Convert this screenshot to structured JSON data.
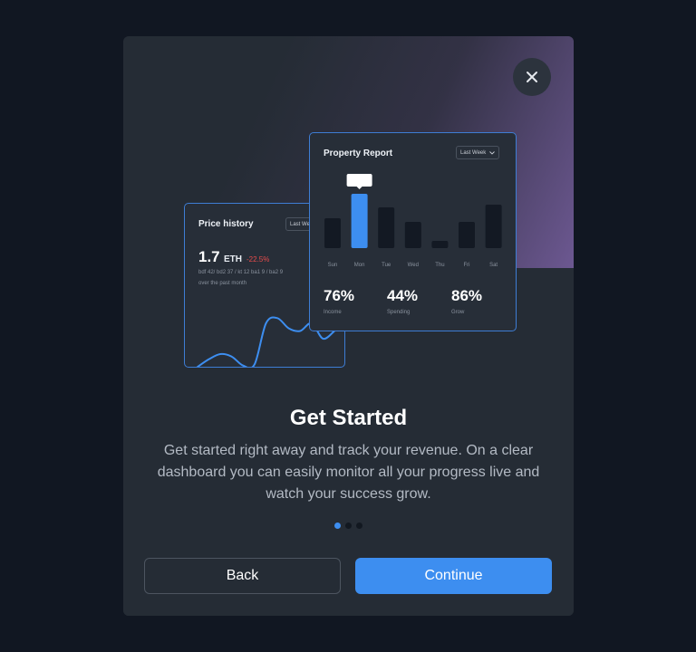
{
  "modal": {
    "close_icon": "close-icon",
    "heading": "Get Started",
    "description": "Get started right away and track your revenue. On a clear dashboard you can easily monitor all your progress live and watch your success grow.",
    "pagination": {
      "total": 3,
      "active": 1
    },
    "buttons": {
      "back": "Back",
      "continue": "Continue"
    }
  },
  "price_card": {
    "title": "Price history",
    "filter": "Last Week",
    "value": "1.7",
    "unit": "ETH",
    "change": "-22.5%",
    "meta_line1": "bdf 42/ bd2 37 / kt 12 ba1 9 / ba2 9",
    "meta_line2": "over the past month"
  },
  "report_card": {
    "title": "Property Report",
    "filter": "Last Week",
    "stats": [
      {
        "value": "76%",
        "label": "Income"
      },
      {
        "value": "44%",
        "label": "Spending"
      },
      {
        "value": "86%",
        "label": "Grow"
      }
    ]
  },
  "chart_data": [
    {
      "type": "bar",
      "categories": [
        "Sun",
        "Mon",
        "Tue",
        "Wed",
        "Thu",
        "Fri",
        "Sat"
      ],
      "values": [
        33,
        60,
        45,
        29,
        8,
        29,
        48
      ],
      "highlighted": "Mon",
      "ylim": [
        0,
        80
      ],
      "grid": false
    },
    {
      "type": "line",
      "x": [
        0,
        1,
        2,
        3,
        4,
        5,
        6,
        7,
        8,
        9,
        10,
        11,
        12
      ],
      "values": [
        2,
        8,
        12,
        10,
        3,
        4,
        36,
        40,
        32,
        30,
        36,
        24,
        30
      ],
      "ylim": [
        0,
        48
      ],
      "grid": false
    }
  ],
  "colors": {
    "accent": "#3d8ef0",
    "negative": "#e84c4c",
    "bar_default": "#131923"
  }
}
